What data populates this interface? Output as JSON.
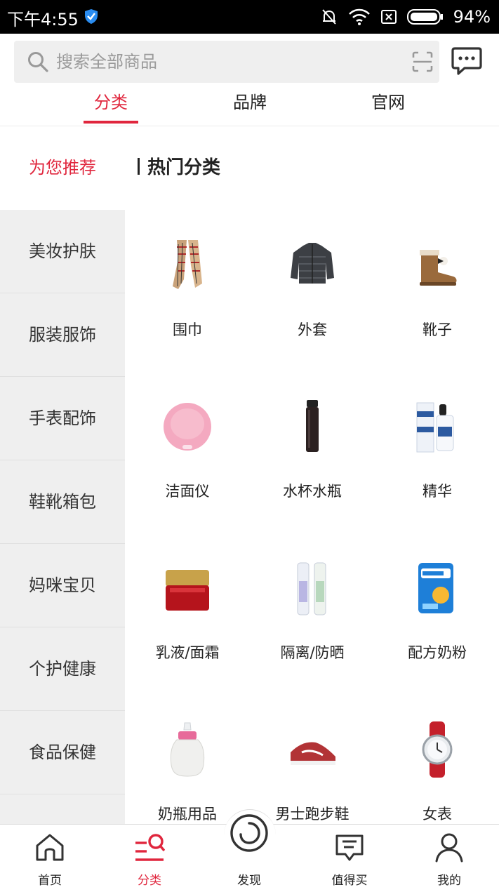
{
  "status_bar": {
    "time": "下午4:55",
    "battery": "94%"
  },
  "search": {
    "placeholder": "搜索全部商品"
  },
  "tabs": [
    {
      "label": "分类",
      "active": true
    },
    {
      "label": "品牌",
      "active": false
    },
    {
      "label": "官网",
      "active": false
    }
  ],
  "sidebar": {
    "items": [
      {
        "label": "为您推荐",
        "active": true
      },
      {
        "label": "美妆护肤"
      },
      {
        "label": "服装服饰"
      },
      {
        "label": "手表配饰"
      },
      {
        "label": "鞋靴箱包"
      },
      {
        "label": "妈咪宝贝"
      },
      {
        "label": "个护健康"
      },
      {
        "label": "食品保健"
      }
    ]
  },
  "section": {
    "title": "热门分类"
  },
  "categories": [
    {
      "label": "围巾",
      "icon": "scarf-icon"
    },
    {
      "label": "外套",
      "icon": "jacket-icon"
    },
    {
      "label": "靴子",
      "icon": "boot-icon"
    },
    {
      "label": "洁面仪",
      "icon": "face-cleanser-icon"
    },
    {
      "label": "水杯水瓶",
      "icon": "bottle-icon"
    },
    {
      "label": "精华",
      "icon": "serum-icon"
    },
    {
      "label": "乳液/面霜",
      "icon": "cream-jar-icon"
    },
    {
      "label": "隔离/防晒",
      "icon": "sunscreen-icon"
    },
    {
      "label": "配方奶粉",
      "icon": "milk-powder-icon"
    },
    {
      "label": "奶瓶用品",
      "icon": "baby-bottle-icon"
    },
    {
      "label": "男士跑步鞋",
      "icon": "running-shoe-icon"
    },
    {
      "label": "女表",
      "icon": "watch-icon"
    }
  ],
  "bottom_nav": [
    {
      "label": "首页",
      "icon": "home-icon"
    },
    {
      "label": "分类",
      "icon": "category-icon",
      "active": true
    },
    {
      "label": "发现",
      "icon": "discover-icon"
    },
    {
      "label": "值得买",
      "icon": "deal-icon"
    },
    {
      "label": "我的",
      "icon": "profile-icon"
    }
  ],
  "colors": {
    "accent": "#e0263d",
    "sidebar_bg": "#efefef",
    "search_bg": "#efefef"
  }
}
